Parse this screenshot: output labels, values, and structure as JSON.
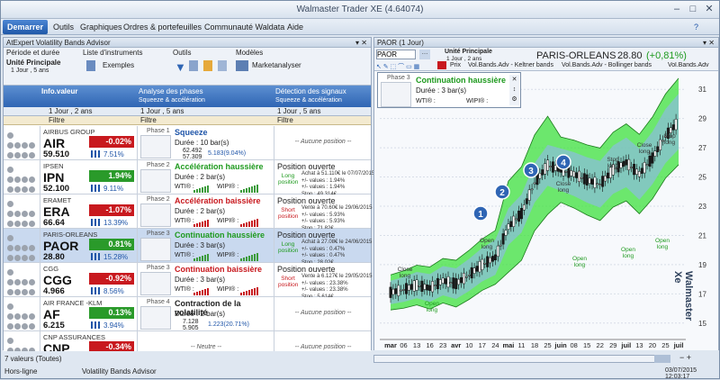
{
  "window": {
    "title": "Walmaster Trader XE",
    "version": "(4.64074)"
  },
  "ribbon": {
    "start": "Demarrer",
    "tabs": [
      "Outils",
      "Graphiques",
      "Ordres & portefeuilles",
      "Communauté Waldata",
      "Aide"
    ]
  },
  "left": {
    "panel_title": "AtExpert Volatility Bands Advisor",
    "toolbar": {
      "g1": "Période et durée",
      "unit": "Unité Principale",
      "unit_sub": "1 Jour , 5 ans",
      "g2": "Liste d'instruments",
      "list": "Exemples",
      "g3": "Outils",
      "g4": "Modèles",
      "model": "Marketanalyser"
    },
    "headers": {
      "info": "Info.valeur",
      "analyse": "Analyse des phases",
      "analyse_sub": "Squeeze & accélération",
      "detect": "Détection des signaux",
      "detect_sub": "Squeeze & accélération"
    },
    "sub": {
      "s1": "1 Jour , 2 ans",
      "s2": "1 Jour , 5 ans",
      "s3": "1 Jour , 5 ans"
    },
    "filter": "Filtre",
    "rows": [
      {
        "name": "AIRBUS GROUP",
        "ticker": "AIR",
        "price": "59.510",
        "chg": "-0.02%",
        "pct": "7.51%",
        "dir": "neg",
        "phase_lbl": "Phase 1",
        "phase": "Squeeze",
        "phase_color": "#1f55a8",
        "dur": "Durée :    10 bar(s)",
        "w1": "62.492",
        "w2": "57.309",
        "w3": "5.183(9.04%)",
        "sig": "",
        "sig_s": "",
        "sig_d": "",
        "empty": "-- Aucune position --"
      },
      {
        "name": "IPSEN",
        "ticker": "IPN",
        "price": "52.100",
        "chg": "1.94%",
        "pct": "9.11%",
        "dir": "pos",
        "phase_lbl": "Phase 2",
        "phase": "Accélération haussière",
        "phase_color": "#1e9a1e",
        "dur": "Durée :    2 bar(s)",
        "w1": "WTI® :",
        "w2": "WIPI® :",
        "w3": "",
        "sig": "Position ouverte",
        "sig_s": "Long position",
        "sig_d": "Achat à 51.110€ le 07/07/2015\n+/- values : 1.94%\n+/- values : 1.94%\nStop : 49.314€",
        "empty": ""
      },
      {
        "name": "ERAMET",
        "ticker": "ERA",
        "price": "66.64",
        "chg": "-1.07%",
        "pct": "13.39%",
        "dir": "neg",
        "phase_lbl": "Phase 2",
        "phase": "Accélération baissière",
        "phase_color": "#c8191e",
        "dur": "Durée :    2 bar(s)",
        "w1": "WTI® :",
        "w2": "WIPI® :",
        "w3": "",
        "sig": "Position ouverte",
        "sig_s": "Short position",
        "sig_d": "Vente à 70.60€ le 29/06/2015\n+/- values : 5.93%\n+/- values : 5.93%\nStop : 71.82€",
        "empty": ""
      },
      {
        "name": "PARIS-ORLEANS",
        "ticker": "PAOR",
        "price": "28.80",
        "chg": "0.81%",
        "pct": "15.28%",
        "dir": "pos",
        "phase_lbl": "Phase 3",
        "phase": "Continuation haussière",
        "phase_color": "#1e9a1e",
        "dur": "Durée :    3 bar(s)",
        "w1": "WTI® :",
        "w2": "WIPI® :",
        "w3": "",
        "sig": "Position ouverte",
        "sig_s": "Long position",
        "sig_d": "Achat à 27.08€ le 24/06/2015\n+/- values : 0.47%\n+/- values : 0.47%\nStop : 28.02€",
        "empty": ""
      },
      {
        "name": "CGG",
        "ticker": "CGG",
        "price": "4.966",
        "chg": "-0.92%",
        "pct": "8.56%",
        "dir": "neg",
        "phase_lbl": "Phase 3",
        "phase": "Continuation baissière",
        "phase_color": "#c8191e",
        "dur": "Durée :    3 bar(s)",
        "w1": "WTI® :",
        "w2": "WIPI® :",
        "w3": "",
        "sig": "Position ouverte",
        "sig_s": "Short position",
        "sig_d": "Vente à 6.127€ le 29/05/2015\n+/- values : 23.38%\n+/- values : 23.38%\nStop : 5.614€",
        "empty": ""
      },
      {
        "name": "AIR FRANCE -KLM",
        "ticker": "AF",
        "price": "6.215",
        "chg": "0.13%",
        "pct": "3.94%",
        "dir": "pos",
        "phase_lbl": "Phase 4",
        "phase": "Contraction de la volatilité",
        "phase_color": "#222",
        "dur": "Durée :    2 bar(s)",
        "w1": "7.128",
        "w2": "5.905",
        "w3": "1.223(20.71%)",
        "sig": "",
        "sig_s": "",
        "sig_d": "",
        "empty": "-- Aucune position --"
      },
      {
        "name": "CNP ASSURANCES",
        "ticker": "CNP",
        "price": "14.760",
        "chg": "-0.34%",
        "pct": "7.60%",
        "dir": "neg",
        "phase_lbl": "",
        "phase": "",
        "phase_color": "#222",
        "dur": "",
        "w1": "",
        "w2": "",
        "w3": "",
        "sig": "",
        "sig_s": "",
        "sig_d": "",
        "empty": "-- Aucune position --",
        "neutre": "-- Neutre --"
      }
    ]
  },
  "right": {
    "panel_title": "PAOR (1 Jour)",
    "symbol": "PAOR",
    "unit": "Unité Principale",
    "unit_sub": "1 Jour , 2 ans",
    "instrument": "PARIS-ORLEANS",
    "last": "28.80",
    "change": "(+0,81%)",
    "legend": [
      "Prix",
      "Vol.Bands.Adv - Keltner bands",
      "Vol.Bands.Adv - Bollinger bands",
      "Vol.Bands.Adv"
    ],
    "overlay": {
      "phase": "Phase 3",
      "title": "Continuation haussière",
      "dur": "Durée :    3 bar(s)",
      "wti": "WTI® :",
      "wipi": "WIPI® :"
    },
    "labels": [
      "Close long",
      "Open long",
      "Close long",
      "Stop long",
      "Close long",
      "Stop long",
      "Open long",
      "Open long",
      "Open long",
      "Open long"
    ],
    "markers": [
      "1",
      "2",
      "3",
      "4"
    ],
    "watermark": "Walmaster Xe"
  },
  "chart_data": {
    "type": "line",
    "x": [
      "mar",
      "06",
      "13",
      "16",
      "23",
      "avr",
      "10",
      "17",
      "24",
      "mai",
      "11",
      "18",
      "25",
      "juin",
      "08",
      "15",
      "22",
      "29",
      "juil",
      "13",
      "20",
      "25",
      "juil"
    ],
    "yticks": [
      15,
      17,
      19,
      21,
      23,
      25,
      27,
      29,
      31
    ],
    "ylim": [
      14,
      32
    ],
    "values": [
      17.1,
      17.3,
      17.6,
      17.4,
      17.9,
      17.7,
      18.3,
      19.0,
      19.5,
      21.6,
      22.5,
      24.6,
      25.8,
      25.5,
      25.2,
      24.8,
      24.5,
      25.5,
      26.0,
      25.2,
      26.3,
      27.8,
      28.8
    ]
  },
  "status": {
    "count": "7 valeurs (Toutes)",
    "conn": "Hors-ligne",
    "module": "Volatility Bands Advisor",
    "datetime": "03/07/2015 12:03:17"
  }
}
